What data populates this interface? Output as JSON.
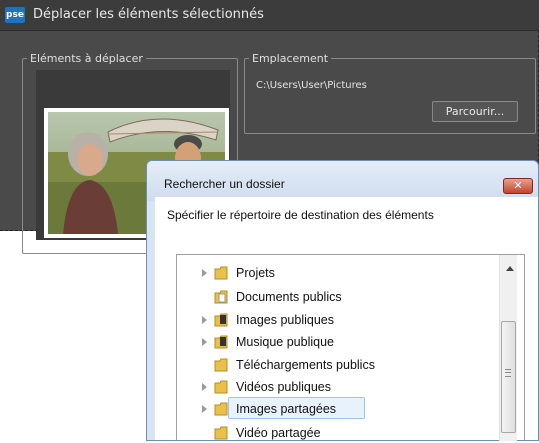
{
  "parent_dialog": {
    "app_badge": "pse",
    "title": "Déplacer les éléments sélectionnés",
    "items_group_label": "Eléments à déplacer",
    "location_group_label": "Emplacement",
    "location_path": "C:\\Users\\User\\Pictures",
    "browse_button": "Parcourir..."
  },
  "folder_dialog": {
    "title": "Rechercher un dossier",
    "close_symbol": "✕",
    "instruction": "Spécifier le répertoire de destination des éléments",
    "tree_items": [
      {
        "label": "Projets",
        "has_expander": true,
        "icon": "folder-icon"
      },
      {
        "label": "Documents publics",
        "has_expander": false,
        "icon": "documents-folder-icon"
      },
      {
        "label": "Images publiques",
        "has_expander": true,
        "icon": "pictures-folder-icon"
      },
      {
        "label": "Musique publique",
        "has_expander": true,
        "icon": "music-folder-icon"
      },
      {
        "label": "Téléchargements publics",
        "has_expander": false,
        "icon": "folder-icon"
      },
      {
        "label": "Vidéos publiques",
        "has_expander": true,
        "icon": "folder-icon"
      },
      {
        "label": "Images partagées",
        "has_expander": true,
        "icon": "folder-icon",
        "selected": true
      },
      {
        "label": "Vidéo partagée",
        "has_expander": false,
        "icon": "folder-icon"
      }
    ]
  },
  "colors": {
    "parent_bg": "#4a4a4a",
    "selection_bg": "#e8f2fd",
    "selection_border": "#9dc5ef",
    "folder_yellow": "#e8c14a"
  }
}
